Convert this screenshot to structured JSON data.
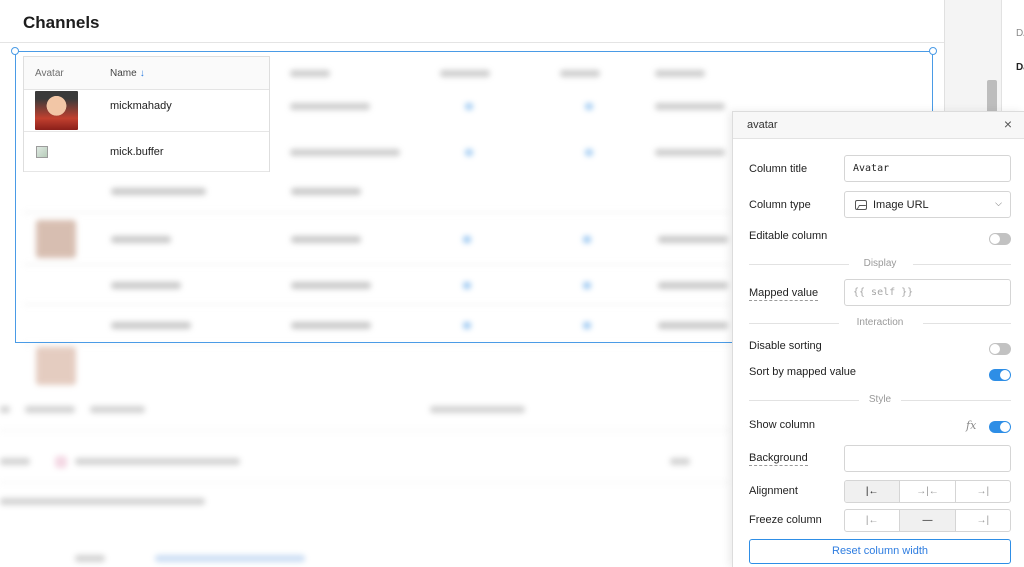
{
  "page": {
    "title": "Channels"
  },
  "right_strip": {
    "label_1": "DA",
    "label_2": "Da"
  },
  "table": {
    "headers": {
      "avatar": "Avatar",
      "name": "Name",
      "sort_indicator": "↓"
    },
    "rows": [
      {
        "name": "mickmahady",
        "avatar": "photo"
      },
      {
        "name": "mick.buffer",
        "avatar": "broken-image"
      }
    ]
  },
  "panel": {
    "title": "avatar",
    "close_icon": "×",
    "column_title": {
      "label": "Column title",
      "value": "Avatar"
    },
    "column_type": {
      "label": "Column type",
      "value": "Image URL",
      "chevron": "⌵"
    },
    "editable_column": {
      "label": "Editable column",
      "on": false
    },
    "sections": {
      "display": "Display",
      "interaction": "Interaction",
      "style": "Style"
    },
    "mapped_value": {
      "label": "Mapped value",
      "placeholder": "{{ self }}"
    },
    "disable_sorting": {
      "label": "Disable sorting",
      "on": false
    },
    "sort_by_mapped": {
      "label": "Sort by mapped value",
      "on": true
    },
    "show_column": {
      "label": "Show column",
      "fx": "fx",
      "on": true
    },
    "background": {
      "label": "Background",
      "value": ""
    },
    "alignment": {
      "label": "Alignment",
      "options": [
        "|←",
        "→|←",
        "→|"
      ],
      "selected": 0
    },
    "freeze_column": {
      "label": "Freeze column",
      "options": [
        "|←",
        "—",
        "→|"
      ],
      "selected": 1
    },
    "reset_label": "Reset column width"
  },
  "colors": {
    "accent": "#2e8ee6",
    "selection": "#4a9be6"
  }
}
